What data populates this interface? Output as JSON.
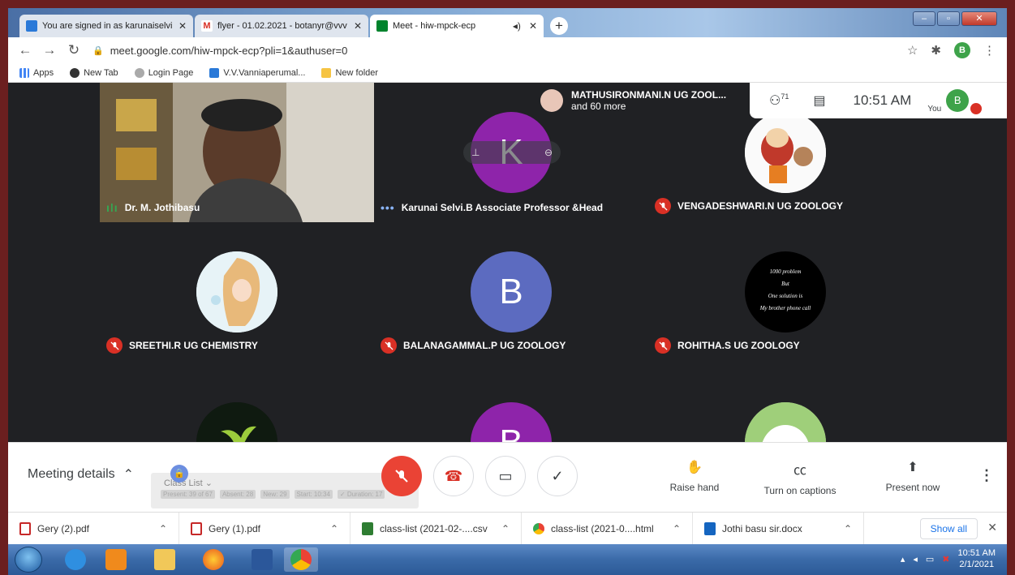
{
  "browser": {
    "tabs": [
      {
        "title": "You are signed in as karunaiselvi",
        "favicon_color": "#2a79d8"
      },
      {
        "title": "flyer - 01.02.2021 - botanyr@vvv",
        "favicon_color": "#d93025"
      },
      {
        "title": "Meet - hiw-mpck-ecp",
        "favicon_color": "#00832d"
      }
    ],
    "url": "meet.google.com/hiw-mpck-ecp?pli=1&authuser=0",
    "profile_initial": "B",
    "bookmarks": [
      "Apps",
      "New Tab",
      "Login Page",
      "V.V.Vanniaperumal...",
      "New folder"
    ]
  },
  "meet": {
    "participants": [
      {
        "name": "Dr. M. Jothibasu",
        "status": "speaking",
        "kind": "video"
      },
      {
        "name": "Karunai Selvi.B Associate Professor &Head",
        "status": "more",
        "kind": "letter",
        "letter": "K",
        "color": "#8e24aa"
      },
      {
        "name": "VENGADESHWARI.N UG ZOOLOGY",
        "status": "muted",
        "kind": "picture",
        "picture": "ganesha-cartoon"
      },
      {
        "name": "SREETHI.R UG CHEMISTRY",
        "status": "muted",
        "kind": "picture",
        "picture": "girl-illustration"
      },
      {
        "name": "BALANAGAMMAL.P UG ZOOLOGY",
        "status": "muted",
        "kind": "letter",
        "letter": "B",
        "color": "#5c6bc0"
      },
      {
        "name": "ROHITHA.S UG ZOOLOGY",
        "status": "muted",
        "kind": "picture",
        "picture": "quote-text"
      },
      {
        "name": "",
        "kind": "picture",
        "picture": "plant-sprout"
      },
      {
        "name": "",
        "kind": "letter",
        "letter": "B",
        "color": "#8e24aa"
      },
      {
        "name": "",
        "kind": "picture",
        "picture": "white-puppy"
      }
    ],
    "quote_lines": [
      "1000 problem",
      "But",
      "One solution is",
      "My brother phone call"
    ],
    "presenter_banner": {
      "name": "MATHUSIRONMANI.N UG ZOOL...",
      "sub": "and 60 more"
    },
    "people_count": "71",
    "time": "10:51 AM",
    "self_label": "You",
    "self_initial": "B",
    "controls": {
      "meeting_details": "Meeting details",
      "raise_hand": "Raise hand",
      "captions": "Turn on captions",
      "present": "Present now"
    },
    "overlay": {
      "title": "Class List",
      "chips": [
        "Present: 39 of 67",
        "Absent: 28",
        "New: 29",
        "Start: 10:34",
        "✓ Duration: 17"
      ]
    }
  },
  "downloads": {
    "items": [
      {
        "name": "Gery (2).pdf",
        "icon_color": "#c62828"
      },
      {
        "name": "Gery (1).pdf",
        "icon_color": "#c62828"
      },
      {
        "name": "class-list (2021-02-....csv",
        "icon_color": "#2e7d32"
      },
      {
        "name": "class-list (2021-0....html",
        "icon_color": "#4285f4"
      },
      {
        "name": "Jothi basu sir.docx",
        "icon_color": "#1565c0"
      }
    ],
    "show_all": "Show all"
  },
  "taskbar": {
    "time": "10:51 AM",
    "date": "2/1/2021"
  }
}
